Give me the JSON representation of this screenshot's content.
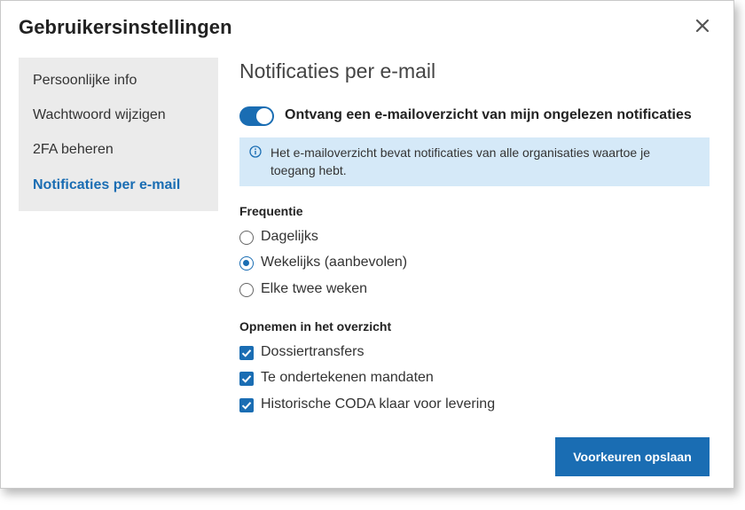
{
  "modal": {
    "title": "Gebruikersinstellingen",
    "close_icon": "close-icon"
  },
  "sidebar": {
    "items": [
      {
        "label": "Persoonlijke info",
        "active": false
      },
      {
        "label": "Wachtwoord wijzigen",
        "active": false
      },
      {
        "label": "2FA beheren",
        "active": false
      },
      {
        "label": "Notificaties per e-mail",
        "active": true
      }
    ]
  },
  "main": {
    "title": "Notificaties per e-mail",
    "toggle": {
      "label": "Ontvang een e-mailoverzicht van mijn ongelezen notificaties",
      "on": true
    },
    "info": {
      "icon": "info-icon",
      "text": "Het e-mailoverzicht bevat notificaties van alle organisaties waartoe je toegang hebt."
    },
    "frequency": {
      "label": "Frequentie",
      "options": [
        {
          "label": "Dagelijks",
          "checked": false
        },
        {
          "label": "Wekelijks (aanbevolen)",
          "checked": true
        },
        {
          "label": "Elke twee weken",
          "checked": false
        }
      ]
    },
    "include": {
      "label": "Opnemen in het overzicht",
      "options": [
        {
          "label": "Dossiertransfers",
          "checked": true
        },
        {
          "label": "Te ondertekenen mandaten",
          "checked": true
        },
        {
          "label": "Historische CODA klaar voor levering",
          "checked": true
        }
      ]
    },
    "save_label": "Voorkeuren opslaan"
  },
  "colors": {
    "accent": "#1a6db3",
    "info_bg": "#d5e9f8",
    "sidebar_bg": "#ebebeb"
  }
}
